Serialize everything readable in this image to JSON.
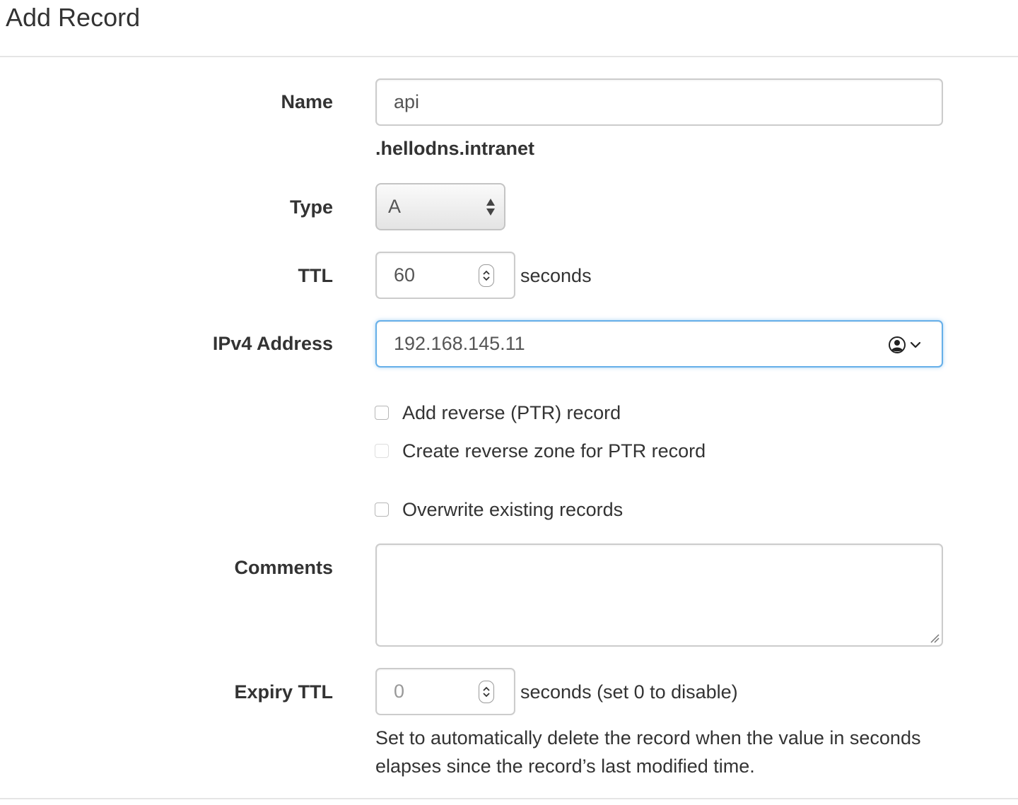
{
  "header": {
    "title": "Add Record"
  },
  "form": {
    "name": {
      "label": "Name",
      "value": "api",
      "suffix": ".hellodns.intranet"
    },
    "type": {
      "label": "Type",
      "selected": "A"
    },
    "ttl": {
      "label": "TTL",
      "value": "60",
      "unit": "seconds"
    },
    "ipv4": {
      "label": "IPv4 Address",
      "value": "192.168.145.11",
      "icons": [
        "user-circle-icon",
        "chevron-down-icon"
      ]
    },
    "options": {
      "add_ptr": {
        "label": "Add reverse (PTR) record",
        "checked": false
      },
      "create_reverse_zone": {
        "label": "Create reverse zone for PTR record",
        "checked": false,
        "disabled": true
      },
      "overwrite": {
        "label": "Overwrite existing records",
        "checked": false
      }
    },
    "comments": {
      "label": "Comments",
      "value": ""
    },
    "expiry_ttl": {
      "label": "Expiry TTL",
      "value": "0",
      "unit": "seconds (set 0 to disable)",
      "help": "Set to automatically delete the record when the value in seconds elapses since the record’s last modified time."
    }
  },
  "colors": {
    "focus_border": "#66afe9",
    "text": "#333333",
    "border": "#cccccc"
  }
}
